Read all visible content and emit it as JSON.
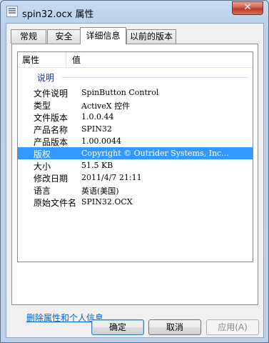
{
  "window": {
    "title": "spin32.ocx 属性",
    "close_label": "✕"
  },
  "tabs": [
    {
      "label": "常规",
      "active": false
    },
    {
      "label": "安全",
      "active": false
    },
    {
      "label": "详细信息",
      "active": true
    },
    {
      "label": "以前的版本",
      "active": false
    }
  ],
  "details": {
    "columns": {
      "property": "属性",
      "value": "值"
    },
    "group_label": "说明",
    "rows": [
      {
        "name": "文件说明",
        "value": "SpinButton Control"
      },
      {
        "name": "类型",
        "value": "ActiveX 控件"
      },
      {
        "name": "文件版本",
        "value": "1.0.0.44"
      },
      {
        "name": "产品名称",
        "value": "SPIN32"
      },
      {
        "name": "产品版本",
        "value": "1.00.0044"
      },
      {
        "name": "版权",
        "value": "Copyright © Outrider Systems, Inc..."
      },
      {
        "name": "大小",
        "value": "51.5 KB"
      },
      {
        "name": "修改日期",
        "value": "2011/4/7 21:11"
      },
      {
        "name": "语言",
        "value": "英语(美国)"
      },
      {
        "name": "原始文件名",
        "value": "SPIN32.OCX"
      }
    ],
    "selected_row_index": 5
  },
  "remove_link": "删除属性和个人信息",
  "buttons": {
    "ok": "确定",
    "cancel": "取消",
    "apply": "应用(A)"
  },
  "colors": {
    "selection": "#3399ff",
    "link": "#0066cc",
    "group_label": "#1e3287"
  },
  "icons": {
    "app_icon": "document-icon",
    "close": "close-icon"
  }
}
